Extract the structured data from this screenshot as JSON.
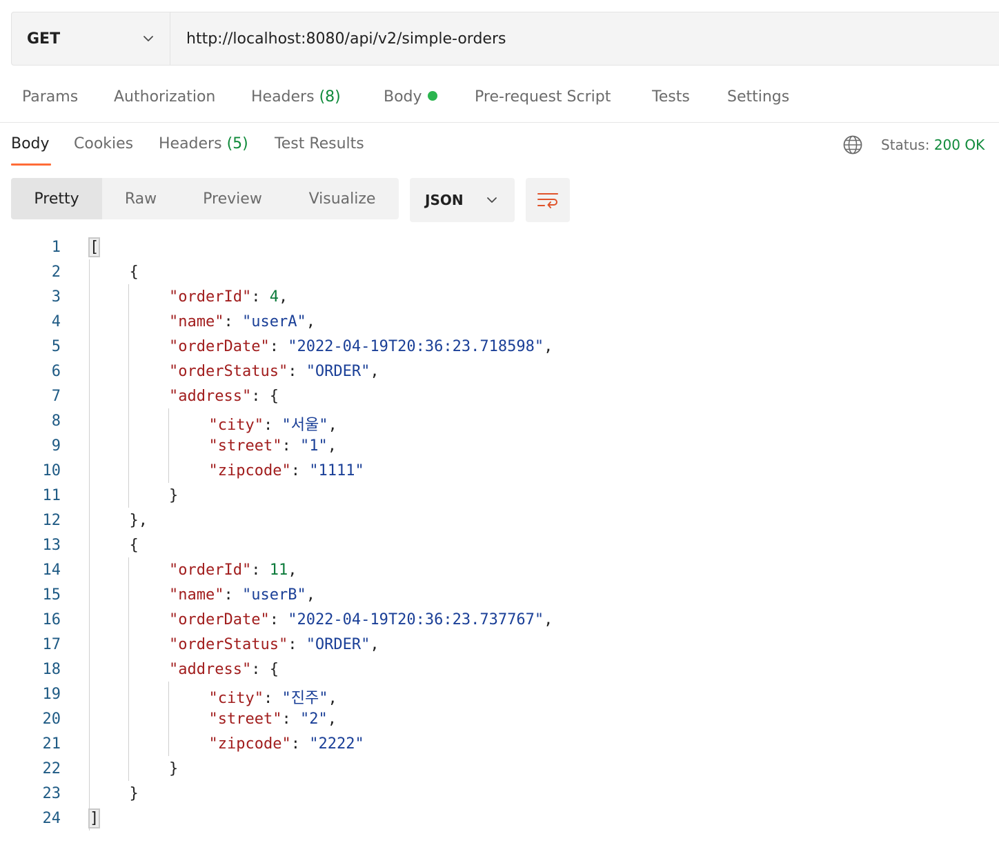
{
  "request": {
    "method": "GET",
    "url": "http://localhost:8080/api/v2/simple-orders"
  },
  "request_tabs": {
    "params": "Params",
    "authorization": "Authorization",
    "headers": "Headers",
    "headers_count": "(8)",
    "body": "Body",
    "prerequest": "Pre-request Script",
    "tests": "Tests",
    "settings": "Settings"
  },
  "response_tabs": {
    "body": "Body",
    "cookies": "Cookies",
    "headers": "Headers",
    "headers_count": "(5)",
    "test_results": "Test Results"
  },
  "status": {
    "label": "Status:",
    "value": "200 OK"
  },
  "view_modes": {
    "pretty": "Pretty",
    "raw": "Raw",
    "preview": "Preview",
    "visualize": "Visualize"
  },
  "format": {
    "selected": "JSON"
  },
  "colors": {
    "accent": "#ff6c37",
    "status_ok": "#0f8a3a",
    "key": "#a11d1d",
    "string": "#1a3f97",
    "number": "#0b7a3a"
  },
  "icons": {
    "method_dropdown": "chevron-down-icon",
    "format_dropdown": "chevron-down-icon",
    "network": "globe-icon",
    "wrap": "wrap-lines-icon"
  },
  "code_lines": [
    {
      "n": "1",
      "indent": 0,
      "parts": [
        [
          "p",
          "["
        ]
      ]
    },
    {
      "n": "2",
      "indent": 1,
      "parts": [
        [
          "p",
          "{"
        ]
      ]
    },
    {
      "n": "3",
      "indent": 2,
      "parts": [
        [
          "k",
          "\"orderId\""
        ],
        [
          "p",
          ": "
        ],
        [
          "n",
          "4"
        ],
        [
          "p",
          ","
        ]
      ]
    },
    {
      "n": "4",
      "indent": 2,
      "parts": [
        [
          "k",
          "\"name\""
        ],
        [
          "p",
          ": "
        ],
        [
          "s",
          "\"userA\""
        ],
        [
          "p",
          ","
        ]
      ]
    },
    {
      "n": "5",
      "indent": 2,
      "parts": [
        [
          "k",
          "\"orderDate\""
        ],
        [
          "p",
          ": "
        ],
        [
          "s",
          "\"2022-04-19T20:36:23.718598\""
        ],
        [
          "p",
          ","
        ]
      ]
    },
    {
      "n": "6",
      "indent": 2,
      "parts": [
        [
          "k",
          "\"orderStatus\""
        ],
        [
          "p",
          ": "
        ],
        [
          "s",
          "\"ORDER\""
        ],
        [
          "p",
          ","
        ]
      ]
    },
    {
      "n": "7",
      "indent": 2,
      "parts": [
        [
          "k",
          "\"address\""
        ],
        [
          "p",
          ": {"
        ]
      ]
    },
    {
      "n": "8",
      "indent": 3,
      "parts": [
        [
          "k",
          "\"city\""
        ],
        [
          "p",
          ": "
        ],
        [
          "s",
          "\"서울\""
        ],
        [
          "p",
          ","
        ]
      ]
    },
    {
      "n": "9",
      "indent": 3,
      "parts": [
        [
          "k",
          "\"street\""
        ],
        [
          "p",
          ": "
        ],
        [
          "s",
          "\"1\""
        ],
        [
          "p",
          ","
        ]
      ]
    },
    {
      "n": "10",
      "indent": 3,
      "parts": [
        [
          "k",
          "\"zipcode\""
        ],
        [
          "p",
          ": "
        ],
        [
          "s",
          "\"1111\""
        ]
      ]
    },
    {
      "n": "11",
      "indent": 2,
      "parts": [
        [
          "p",
          "}"
        ]
      ]
    },
    {
      "n": "12",
      "indent": 1,
      "parts": [
        [
          "p",
          "},"
        ]
      ]
    },
    {
      "n": "13",
      "indent": 1,
      "parts": [
        [
          "p",
          "{"
        ]
      ]
    },
    {
      "n": "14",
      "indent": 2,
      "parts": [
        [
          "k",
          "\"orderId\""
        ],
        [
          "p",
          ": "
        ],
        [
          "n",
          "11"
        ],
        [
          "p",
          ","
        ]
      ]
    },
    {
      "n": "15",
      "indent": 2,
      "parts": [
        [
          "k",
          "\"name\""
        ],
        [
          "p",
          ": "
        ],
        [
          "s",
          "\"userB\""
        ],
        [
          "p",
          ","
        ]
      ]
    },
    {
      "n": "16",
      "indent": 2,
      "parts": [
        [
          "k",
          "\"orderDate\""
        ],
        [
          "p",
          ": "
        ],
        [
          "s",
          "\"2022-04-19T20:36:23.737767\""
        ],
        [
          "p",
          ","
        ]
      ]
    },
    {
      "n": "17",
      "indent": 2,
      "parts": [
        [
          "k",
          "\"orderStatus\""
        ],
        [
          "p",
          ": "
        ],
        [
          "s",
          "\"ORDER\""
        ],
        [
          "p",
          ","
        ]
      ]
    },
    {
      "n": "18",
      "indent": 2,
      "parts": [
        [
          "k",
          "\"address\""
        ],
        [
          "p",
          ": {"
        ]
      ]
    },
    {
      "n": "19",
      "indent": 3,
      "parts": [
        [
          "k",
          "\"city\""
        ],
        [
          "p",
          ": "
        ],
        [
          "s",
          "\"진주\""
        ],
        [
          "p",
          ","
        ]
      ]
    },
    {
      "n": "20",
      "indent": 3,
      "parts": [
        [
          "k",
          "\"street\""
        ],
        [
          "p",
          ": "
        ],
        [
          "s",
          "\"2\""
        ],
        [
          "p",
          ","
        ]
      ]
    },
    {
      "n": "21",
      "indent": 3,
      "parts": [
        [
          "k",
          "\"zipcode\""
        ],
        [
          "p",
          ": "
        ],
        [
          "s",
          "\"2222\""
        ]
      ]
    },
    {
      "n": "22",
      "indent": 2,
      "parts": [
        [
          "p",
          "}"
        ]
      ]
    },
    {
      "n": "23",
      "indent": 1,
      "parts": [
        [
          "p",
          "}"
        ]
      ]
    },
    {
      "n": "24",
      "indent": 0,
      "parts": [
        [
          "p",
          "]"
        ]
      ]
    }
  ]
}
